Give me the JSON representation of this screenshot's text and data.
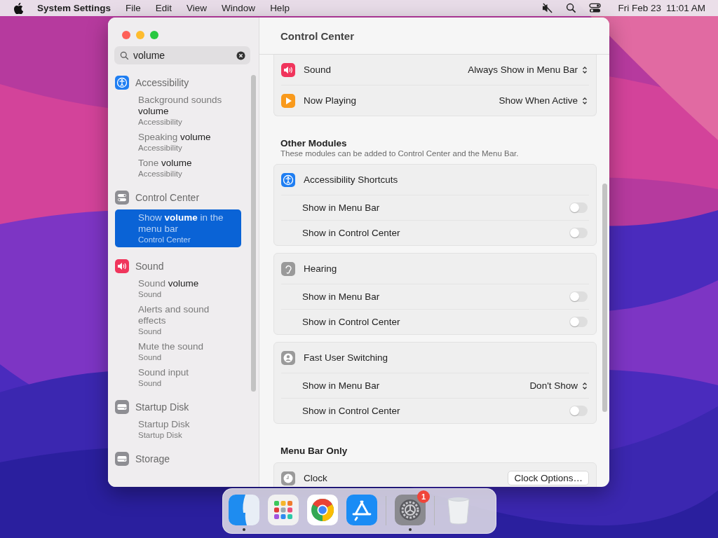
{
  "menu_bar": {
    "app_name": "System Settings",
    "menus": [
      "File",
      "Edit",
      "View",
      "Window",
      "Help"
    ],
    "date": "Fri Feb 23",
    "time": "11:01 AM"
  },
  "window": {
    "title": "Control Center"
  },
  "sidebar": {
    "search": {
      "value": "volume"
    },
    "groups": [
      {
        "title": "Accessibility",
        "kind": "accessibility",
        "results": [
          {
            "text": "Background sounds **volume**",
            "category": "Accessibility",
            "selected": false
          },
          {
            "text": "Speaking **volume**",
            "category": "Accessibility",
            "selected": false
          },
          {
            "text": "Tone **volume**",
            "category": "Accessibility",
            "selected": false
          }
        ]
      },
      {
        "title": "Control Center",
        "kind": "control-center",
        "results": [
          {
            "text": "Show **volume** in the menu bar",
            "category": "Control Center",
            "selected": true
          }
        ]
      },
      {
        "title": "Sound",
        "kind": "sound",
        "results": [
          {
            "text": "Sound **volume**",
            "category": "Sound",
            "selected": false
          },
          {
            "text": "Alerts and sound effects",
            "category": "Sound",
            "selected": false
          },
          {
            "text": "Mute the sound",
            "category": "Sound",
            "selected": false
          },
          {
            "text": "Sound input",
            "category": "Sound",
            "selected": false
          }
        ]
      },
      {
        "title": "Startup Disk",
        "kind": "drive",
        "results": [
          {
            "text": "Startup Disk",
            "category": "Startup Disk",
            "selected": false
          }
        ]
      },
      {
        "title": "Storage",
        "kind": "drive"
      }
    ]
  },
  "content": {
    "sections": [
      {
        "cards": [
          {
            "rows": [
              {
                "kind": "module",
                "label": "Sound",
                "popup": "Always Show in Menu Bar"
              },
              {
                "kind": "module",
                "label": "Now Playing",
                "popup": "Show When Active"
              }
            ]
          }
        ]
      },
      {
        "heading": "Other Modules",
        "subtitle": "These modules can be added to Control Center and the Menu Bar.",
        "cards": [
          {
            "rows": [
              {
                "kind": "module",
                "label": "Accessibility Shortcuts"
              },
              {
                "kind": "toggle",
                "label": "Show in Menu Bar",
                "on": false
              },
              {
                "kind": "toggle",
                "label": "Show in Control Center",
                "on": false
              }
            ]
          },
          {
            "rows": [
              {
                "kind": "module",
                "label": "Hearing"
              },
              {
                "kind": "toggle",
                "label": "Show in Menu Bar",
                "on": false
              },
              {
                "kind": "toggle",
                "label": "Show in Control Center",
                "on": false
              }
            ]
          },
          {
            "rows": [
              {
                "kind": "module",
                "label": "Fast User Switching"
              },
              {
                "kind": "popup",
                "label": "Show in Menu Bar",
                "popup": "Don't Show"
              },
              {
                "kind": "toggle",
                "label": "Show in Control Center",
                "on": false
              }
            ]
          }
        ]
      },
      {
        "heading": "Menu Bar Only",
        "cards": [
          {
            "rows": [
              {
                "kind": "module",
                "label": "Clock",
                "button": "Clock Options…"
              }
            ]
          }
        ]
      }
    ]
  },
  "dock": {
    "items": [
      {
        "kind": "finder",
        "running": true
      },
      {
        "kind": "launchpad",
        "running": false
      },
      {
        "kind": "chrome",
        "running": false
      },
      {
        "kind": "appstore",
        "running": false
      },
      {
        "kind": "separator"
      },
      {
        "kind": "settings",
        "running": true,
        "badge": "1"
      },
      {
        "kind": "separator"
      },
      {
        "kind": "trash",
        "running": false
      }
    ]
  }
}
